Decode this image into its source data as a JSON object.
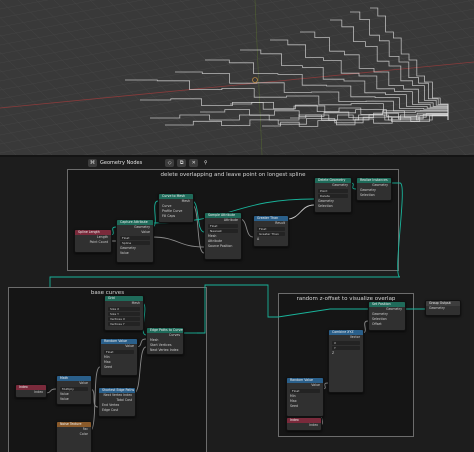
{
  "editor_header": {
    "editor_name": "Geometry Nodes",
    "icons": [
      "node-editor-icon",
      "shield-icon",
      "copy-icon",
      "close-icon",
      "pin-icon"
    ]
  },
  "frames": {
    "top": "delete overlapping and leave point on longest spline",
    "left": "base curves",
    "right": "random z-offset to visualize overlap"
  },
  "nodes": {
    "spline_length": {
      "title": "Spline Length",
      "rows": [
        "Length",
        "Point Count"
      ]
    },
    "capture_attribute": {
      "title": "Capture Attribute",
      "rows": [
        "Geometry",
        "Value",
        "Geometry",
        "Value",
        "Float",
        "Spline"
      ]
    },
    "curve_to_mesh": {
      "title": "Curve to Mesh",
      "rows": [
        "Mesh",
        "Curve",
        "Profile Curve",
        "Fill Caps"
      ]
    },
    "sample_attribute": {
      "title": "Sample Attribute",
      "rows": [
        "Attribute",
        "Float",
        "Nearest",
        "Mesh",
        "Source",
        "Attribute",
        "Source Position"
      ]
    },
    "greater_than": {
      "title": "Greater Than",
      "rows": [
        "Result",
        "Float",
        "Greater Than",
        "A",
        "B"
      ]
    },
    "delete_geometry": {
      "title": "Delete Geometry",
      "rows": [
        "Geometry",
        "Point",
        "Delete",
        "Geometry",
        "Selection"
      ]
    },
    "realize_instances": {
      "title": "Realize Instances",
      "rows": [
        "Geometry",
        "Geometry",
        "Selection"
      ]
    },
    "grid": {
      "title": "Grid",
      "rows": [
        "Mesh",
        "Size X",
        "Size Y",
        "Vertices X",
        "Vertices Y"
      ]
    },
    "random_value": {
      "title": "Random Value",
      "rows": [
        "Value",
        "Float",
        "Min",
        "Max",
        "ID",
        "Seed"
      ]
    },
    "mesh_to_curve": {
      "title": "Mesh to Curve",
      "rows": [
        "Curve",
        "Mesh",
        "Selection"
      ]
    },
    "edge_paths_to_curves": {
      "title": "Edge Paths to Curves",
      "rows": [
        "Curves",
        "Mesh",
        "Start Vertices",
        "Next Vertex Index"
      ]
    },
    "shortest_edge_paths": {
      "title": "Shortest Edge Paths",
      "rows": [
        "Next Vertex Index",
        "Total Cost",
        "End Vertex",
        "Edge Cost"
      ]
    },
    "index_left": {
      "title": "Index",
      "rows": [
        "Index"
      ]
    },
    "math_left": {
      "title": "Math",
      "rows": [
        "Value",
        "Multiply",
        "Value",
        "Value"
      ]
    },
    "noise_texture": {
      "title": "Noise Texture",
      "rows": [
        "Fac",
        "Color"
      ]
    },
    "set_position": {
      "title": "Set Position",
      "rows": [
        "Geometry",
        "Geometry",
        "Selection",
        "Position",
        "Offset"
      ]
    },
    "random_value_r": {
      "title": "Random Value",
      "rows": [
        "Value",
        "Float",
        "Min",
        "Max",
        "ID",
        "Seed"
      ]
    },
    "combine_xyz": {
      "title": "Combine XYZ",
      "rows": [
        "Vector",
        "X",
        "Y",
        "Z"
      ]
    },
    "index_right": {
      "title": "Index",
      "rows": [
        "Index"
      ]
    },
    "group_output": {
      "title": "Group Output",
      "rows": [
        "Geometry"
      ]
    }
  }
}
